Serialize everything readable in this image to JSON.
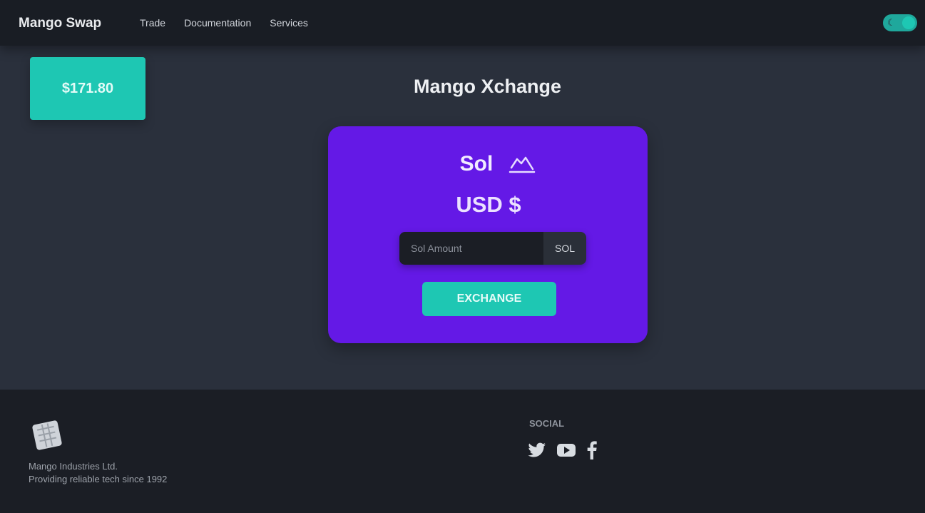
{
  "nav": {
    "brand": "Mango Swap",
    "links": [
      "Trade",
      "Documentation",
      "Services"
    ]
  },
  "price_badge": {
    "text": "$171.80"
  },
  "page": {
    "title": "Mango Xchange"
  },
  "card": {
    "coin": "Sol",
    "usd": "USD $",
    "input": {
      "placeholder": "Sol Amount",
      "value": ""
    },
    "unit": "SOL",
    "button": "EXCHANGE"
  },
  "footer": {
    "line1": "Mango Industries Ltd.",
    "line2": "Providing reliable tech since 1992",
    "social_title": "SOCIAL"
  },
  "colors": {
    "background": "#2a303c",
    "navbar": "#191d24",
    "accent": "#1ec7b3",
    "card": "#6419e6",
    "footer": "#1b1e25"
  },
  "icons": [
    "moon-icon",
    "solana-icon",
    "twitter-icon",
    "youtube-icon",
    "facebook-icon",
    "logo-icon"
  ]
}
